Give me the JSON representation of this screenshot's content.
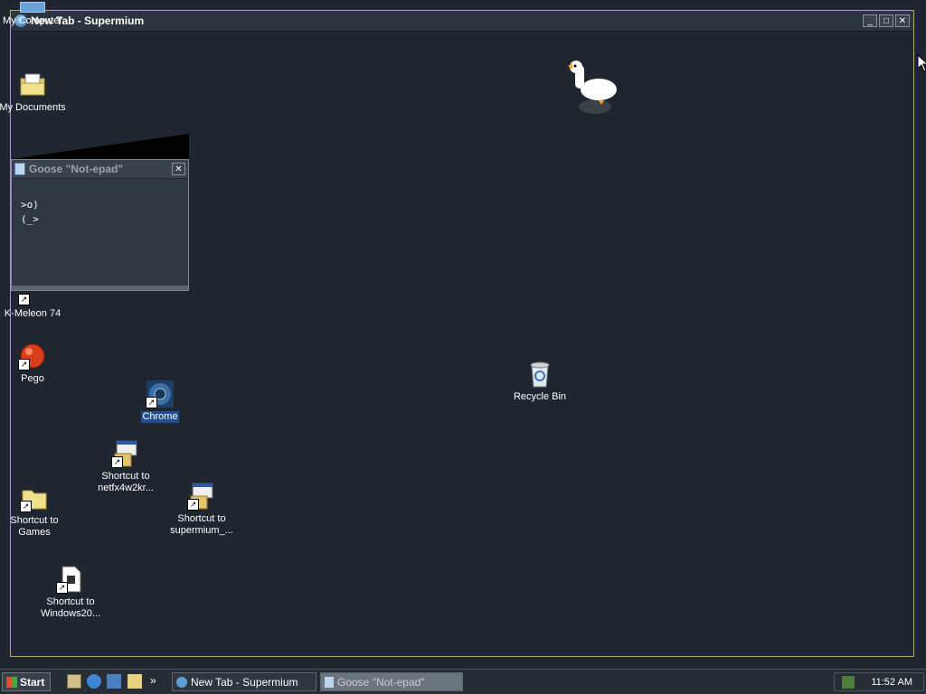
{
  "browser_window": {
    "title": "New Tab - Supermium",
    "buttons": {
      "minimize": "_",
      "maximize": "□",
      "close": "✕"
    }
  },
  "desktop_icons": {
    "my_computer": "My Computer",
    "my_documents": "My Documents",
    "kmeleon": "K-Meleon 74",
    "pego": "Pego",
    "chrome": "Chrome",
    "netfx": {
      "line1": "Shortcut to",
      "line2": "netfx4w2kr..."
    },
    "supermium": {
      "line1": "Shortcut to",
      "line2": "supermium_..."
    },
    "games": {
      "line1": "Shortcut to",
      "line2": "Games"
    },
    "windows": {
      "line1": "Shortcut to",
      "line2": "Windows20..."
    },
    "recycle_bin": "Recycle Bin"
  },
  "goose_window": {
    "title": "Goose \"Not-epad\"",
    "line1": ">o)",
    "line2": "(_>"
  },
  "taskbar": {
    "start": "Start",
    "overflow": "»",
    "task_supermium": "New Tab - Supermium",
    "task_goose": "Goose \"Not-epad\"",
    "clock": "11:52 AM"
  }
}
